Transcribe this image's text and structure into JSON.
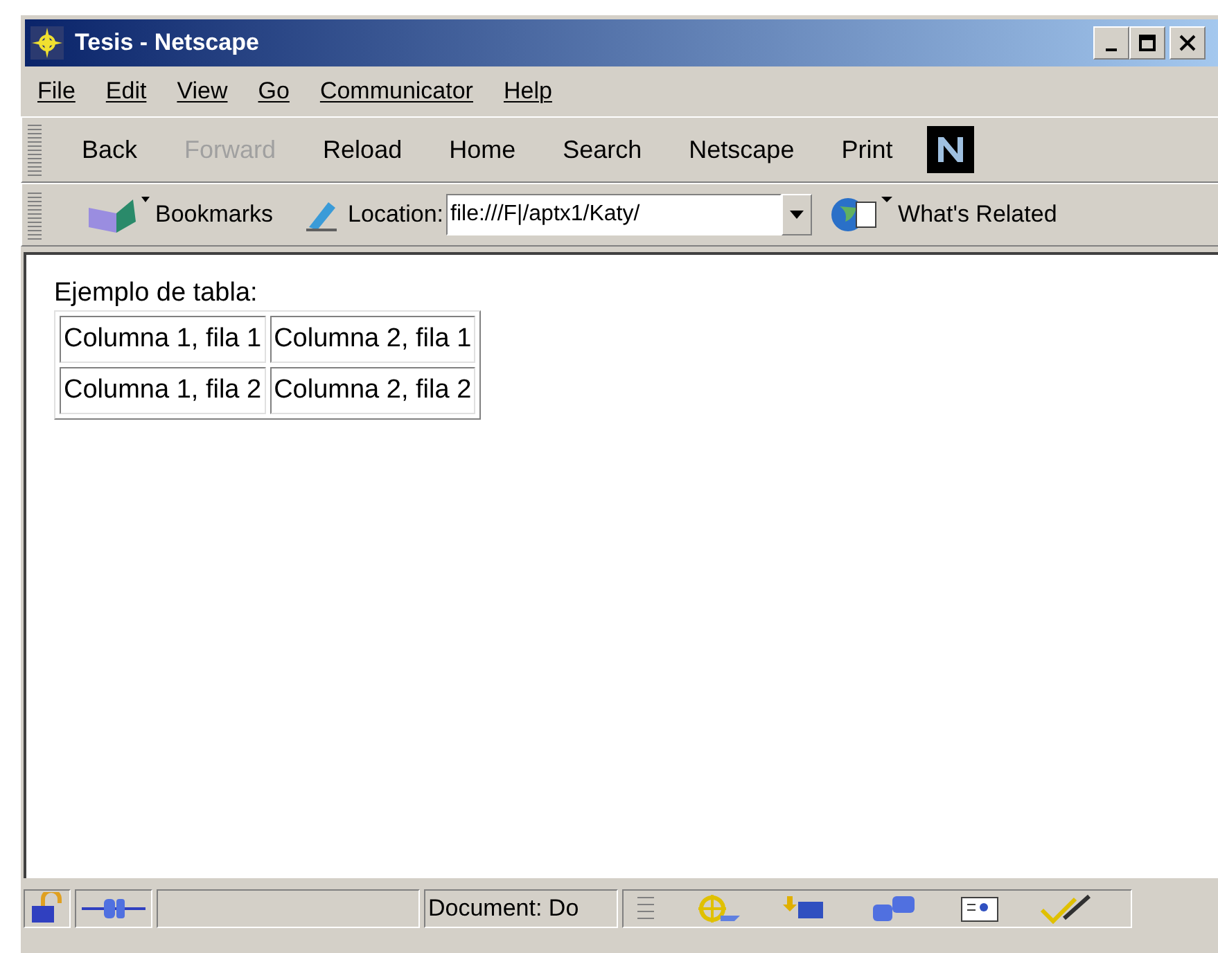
{
  "window": {
    "title": "Tesis - Netscape"
  },
  "menu": [
    "File",
    "Edit",
    "View",
    "Go",
    "Communicator",
    "Help"
  ],
  "toolbar": [
    {
      "label": "Back",
      "disabled": false
    },
    {
      "label": "Forward",
      "disabled": true
    },
    {
      "label": "Reload",
      "disabled": false
    },
    {
      "label": "Home",
      "disabled": false
    },
    {
      "label": "Search",
      "disabled": false
    },
    {
      "label": "Netscape",
      "disabled": false
    },
    {
      "label": "Print",
      "disabled": false
    }
  ],
  "location_bar": {
    "bookmarks": "Bookmarks",
    "location_label": "Location:",
    "url": "file:///F|/aptx1/Katy/",
    "related": "What's Related"
  },
  "content": {
    "heading": "Ejemplo de tabla:",
    "rows": [
      [
        "Columna 1, fila 1",
        "Columna 2, fila 1"
      ],
      [
        "Columna 1, fila 2",
        "Columna 2, fila 2"
      ]
    ]
  },
  "status_bar": {
    "text": "Document: Do"
  }
}
